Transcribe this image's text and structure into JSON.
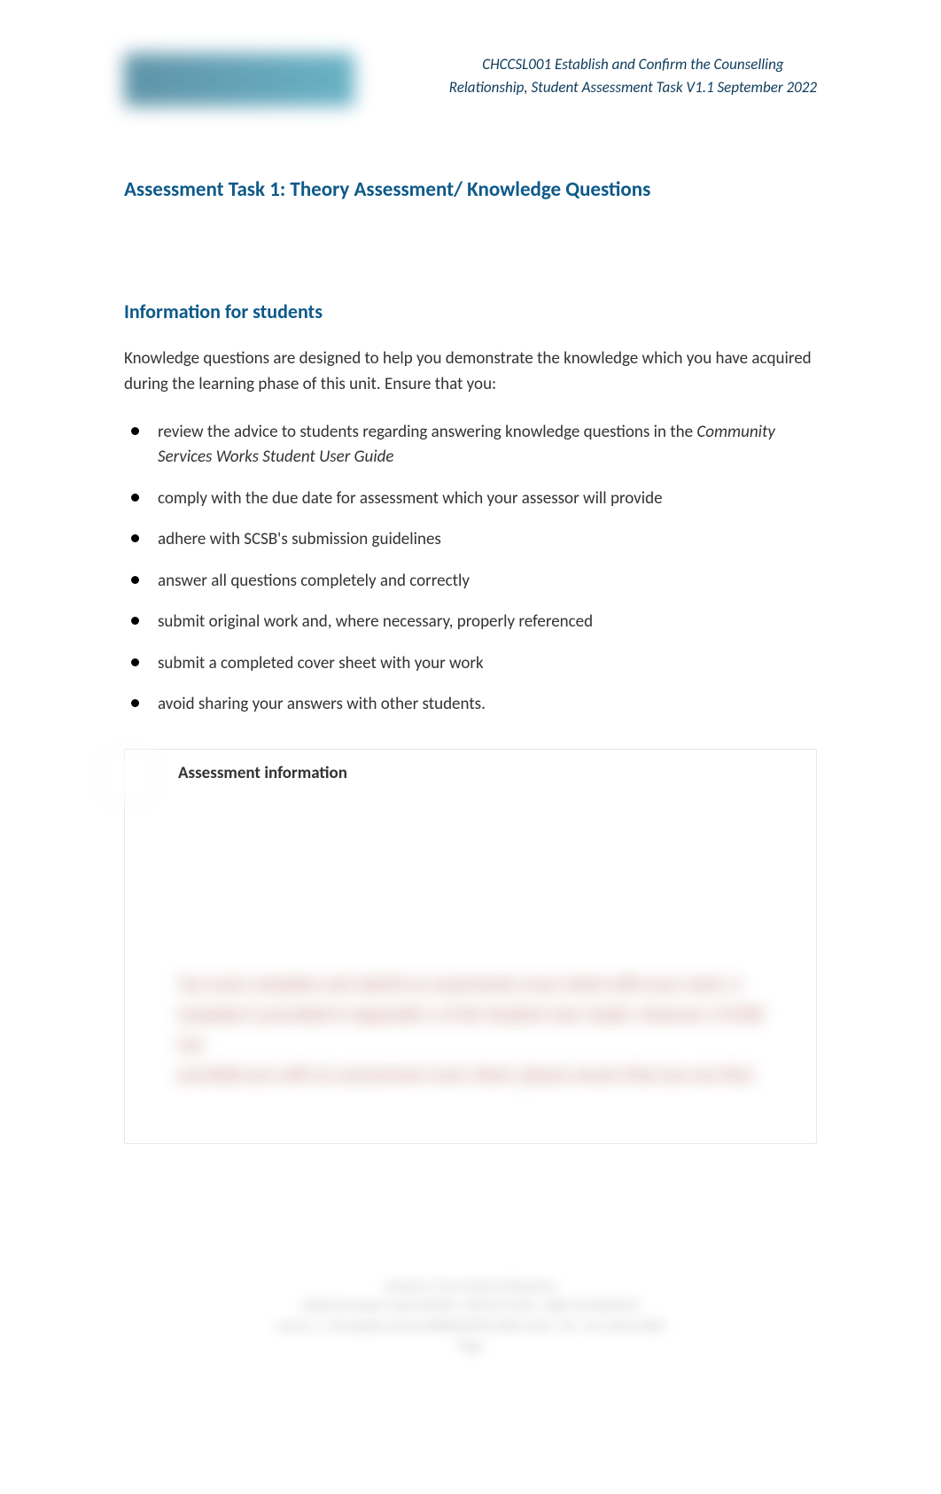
{
  "header": {
    "line1": "CHCCSL001 Establish and Confirm the Counselling",
    "line2": "Relationship, Student Assessment Task V1.1 September 2022"
  },
  "title": "Assessment Task 1: Theory Assessment/ Knowledge Questions",
  "subtitle": "Information for students",
  "intro": "Knowledge questions are designed to help you demonstrate the knowledge which you have acquired during the learning phase of this unit. Ensure that you:",
  "bullets": [
    {
      "pre": "review the advice to students regarding answering knowledge questions in the ",
      "italic": "Community Services Works Student User Guide"
    },
    {
      "pre": "comply with the due date for assessment which your assessor will provide",
      "italic": ""
    },
    {
      "pre": "adhere with SCSB's submission guidelines",
      "italic": ""
    },
    {
      "pre": "answer all questions completely and correctly",
      "italic": ""
    },
    {
      "pre": "submit original work and, where necessary, properly referenced",
      "italic": ""
    },
    {
      "pre": "submit a completed cover sheet with your work",
      "italic": ""
    },
    {
      "pre": "avoid sharing your answers with other students.",
      "italic": ""
    }
  ],
  "info_box": {
    "title": "Assessment information",
    "blurred_line1": "You must complete and submit an assessment cover sheet with your work. A",
    "blurred_line2": "template is provided in Appendix C of the Student User Guide. However, if SCSB has",
    "blurred_line3": "provided you with an assessment cover sheet, please ensure that you use that."
  },
  "footer": {
    "line1": "Southern Cross School of Business",
    "line2": "CRICOS Provider Code 03523D | RTO ID 41253 | ABN 95155625924",
    "line3": "Level 2, 1-3 Fitzwilliam Street PARRAMATTA NSW 2150 | Ph: +61 2 8542 6663",
    "line4": "Page"
  }
}
